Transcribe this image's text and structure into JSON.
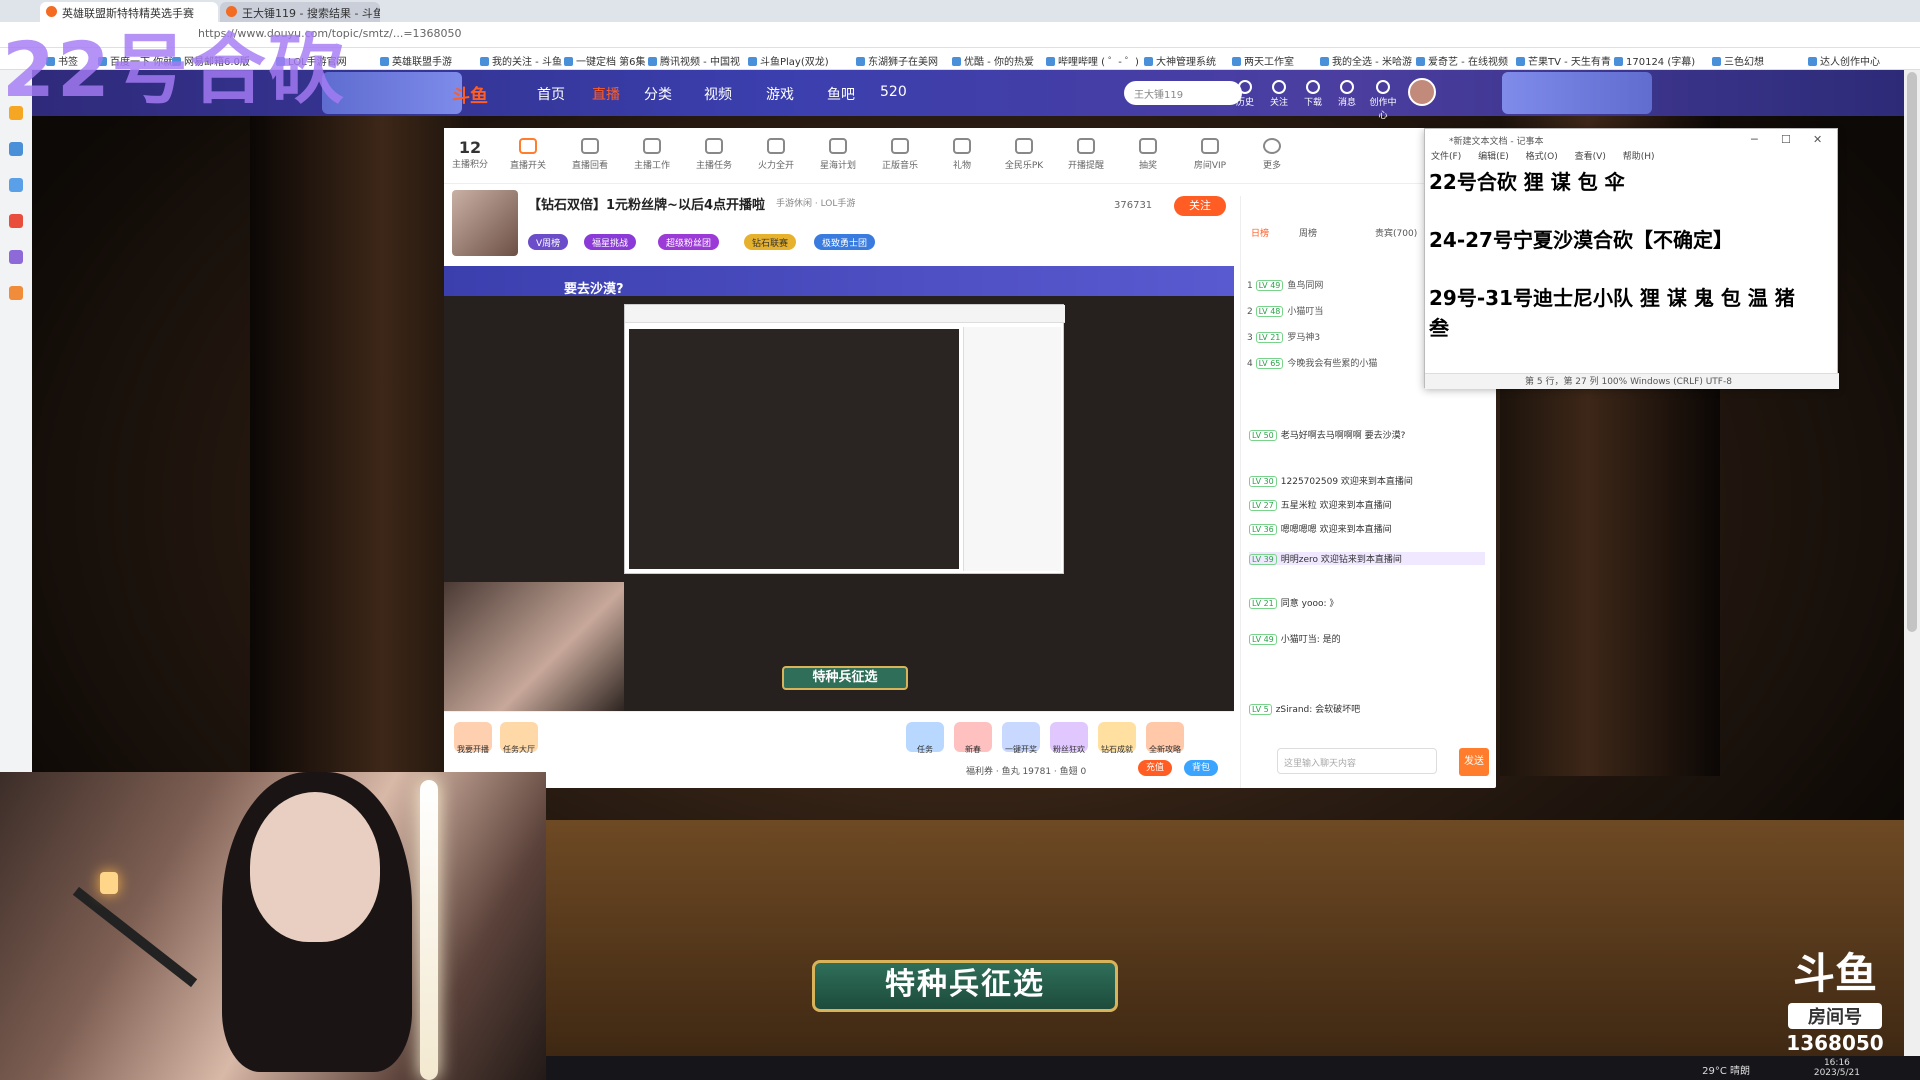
{
  "overlay_text": "22号合砍",
  "browser": {
    "tabs": [
      {
        "label": "英雄联盟斯特特精英选手赛"
      },
      {
        "label": "王大锤119 - 搜索结果 - 斗鱼"
      }
    ],
    "url": "https://www.douyu.com/topic/smtz/...=1368050",
    "bookmarks": [
      "书签",
      "百度一下 你就",
      "网易邮箱6.0版",
      "LOL手游官网",
      "英雄联盟手游",
      "我的关注 - 斗鱼",
      "一键定档 第6集",
      "腾讯视频 - 中国视",
      "斗鱼Play(双龙)",
      "东湖狮子在美网",
      "优酷 - 你的热爱",
      "哔哩哔哩 ( ゜- ゜)",
      "大神管理系统",
      "两天工作室",
      "我的全选 - 米哈游",
      "爱奇艺 - 在线视频",
      "芒果TV - 天生有青",
      "170124 (字幕)",
      "三色幻想",
      "达人创作中心"
    ]
  },
  "douyu": {
    "logo": "斗鱼",
    "nav": [
      "首页",
      "直播",
      "分类",
      "视频",
      "游戏",
      "鱼吧",
      "520"
    ],
    "search_value": "王大锤119",
    "header_icons": [
      "历史",
      "关注",
      "下载",
      "消息",
      "创作中心"
    ],
    "tools": [
      "主播积分",
      "直播开关",
      "直播回看",
      "主播工作",
      "主播任务",
      "火力全开",
      "星海计划",
      "正版音乐",
      "礼物",
      "全民乐PK",
      "开播提醒",
      "抽奖",
      "房间VIP",
      "更多"
    ],
    "tool_count": "12",
    "room_title": "【钻石双倍】1元粉丝牌~以后4点开播啦",
    "category": "手游休闲 · LOL手游",
    "viewers": "376731",
    "follow_label": "关注",
    "badges": [
      "V周榜",
      "福星挑战",
      "超级粉丝团",
      "钻石联赛",
      "极致勇士团"
    ],
    "video_title": "要去沙漠?",
    "video_banner": "特种兵征选",
    "gifts": [
      "我要开播",
      "任务大厅",
      "任务",
      "新春",
      "一键开奖",
      "粉丝狂欢",
      "钻石成就",
      "全新攻略"
    ],
    "fish_info": "福利券 · 鱼丸 19781 · 鱼翅 0",
    "charge_label": "充值",
    "bag_label": "背包"
  },
  "rank_tabs": [
    "日榜",
    "周榜",
    "贵宾(700)"
  ],
  "rank_list": [
    {
      "lv": "LV 49",
      "name": "鱼鸟同网"
    },
    {
      "lv": "LV 48",
      "name": "小猫叮当"
    },
    {
      "lv": "LV 21",
      "name": "罗马神3"
    },
    {
      "lv": "LV 65",
      "name": "今晚我会有些累的小猫"
    }
  ],
  "chat": [
    {
      "lv": "LV 50",
      "text": "老马好啊去马啊啊啊 要去沙漠?"
    },
    {
      "lv": "LV 30",
      "text": "1225702509 欢迎来到本直播间"
    },
    {
      "lv": "LV 27",
      "text": "五星米粒 欢迎来到本直播间"
    },
    {
      "lv": "LV 36",
      "text": "嗯嗯嗯嗯 欢迎来到本直播间"
    },
    {
      "lv": "LV 39",
      "text": "明明zero 欢迎钻来到本直播间"
    },
    {
      "lv": "LV 21",
      "text": "同意 yooo: 》"
    },
    {
      "lv": "LV 49",
      "text": "小猫叮当: 是的"
    },
    {
      "lv": "LV 5",
      "text": "zSirand: 会软破坏吧"
    }
  ],
  "chat_placeholder": "这里输入聊天内容",
  "send_label": "发送",
  "notepad": {
    "title": "*新建文本文档 - 记事本",
    "menu": [
      "文件(F)",
      "编辑(E)",
      "格式(O)",
      "查看(V)",
      "帮助(H)"
    ],
    "lines": [
      "22号合砍 狸 谋 包 伞",
      "24-27号宁夏沙漠合砍【不确定】",
      "29号-31号迪士尼小队 狸 谋 鬼 包 温 猪 叁"
    ],
    "status": "第 5 行，第 27 列    100%    Windows (CRLF)    UTF-8"
  },
  "stage_title": "特种兵征选",
  "watermark": {
    "brand": "斗鱼",
    "label": "房间号",
    "room": "1368050"
  },
  "taskbar": {
    "weather": "29°C 晴朗",
    "time": "16:16",
    "date": "2023/5/21"
  }
}
